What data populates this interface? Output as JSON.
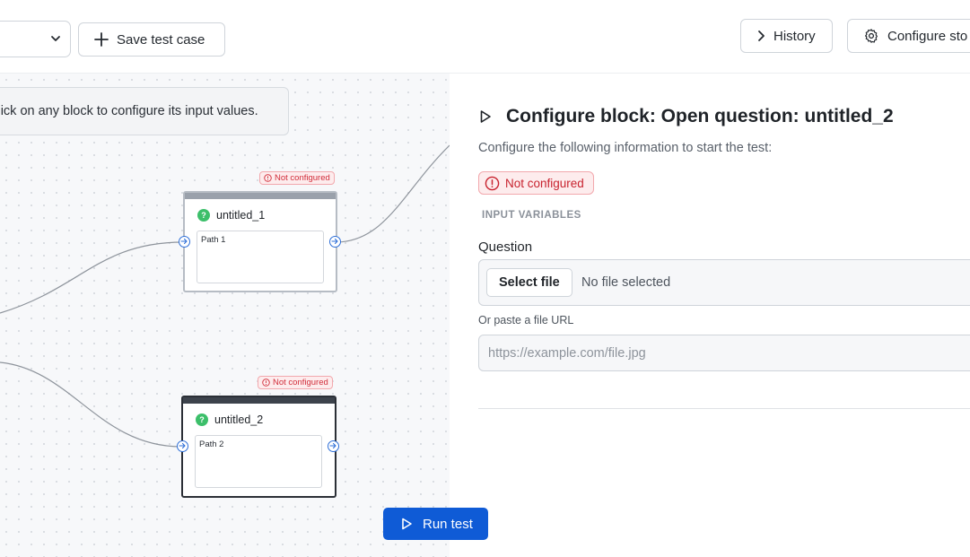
{
  "toolbar": {
    "save_label": "Save test case",
    "history_label": "History",
    "configure_label": "Configure sto"
  },
  "canvas": {
    "hint": "Click on any block to configure its input values.",
    "nodes": [
      {
        "title": "untitled_1",
        "path": "Path 1",
        "badge": "Not configured"
      },
      {
        "title": "untitled_2",
        "path": "Path 2",
        "badge": "Not configured"
      }
    ],
    "run_label": "Run test"
  },
  "panel": {
    "title": "Configure block: Open question: untitled_2",
    "subtitle": "Configure the following information to start the test:",
    "status": "Not configured",
    "section_heading": "INPUT VARIABLES",
    "question_label": "Question",
    "file_button": "Select file",
    "file_status": "No file selected",
    "url_label": "Or paste a file URL",
    "url_placeholder": "https://example.com/file.jpg",
    "url_value": ""
  },
  "colors": {
    "primary": "#0f5bd6",
    "error": "#d12d3a",
    "success": "#3cbf6a"
  }
}
